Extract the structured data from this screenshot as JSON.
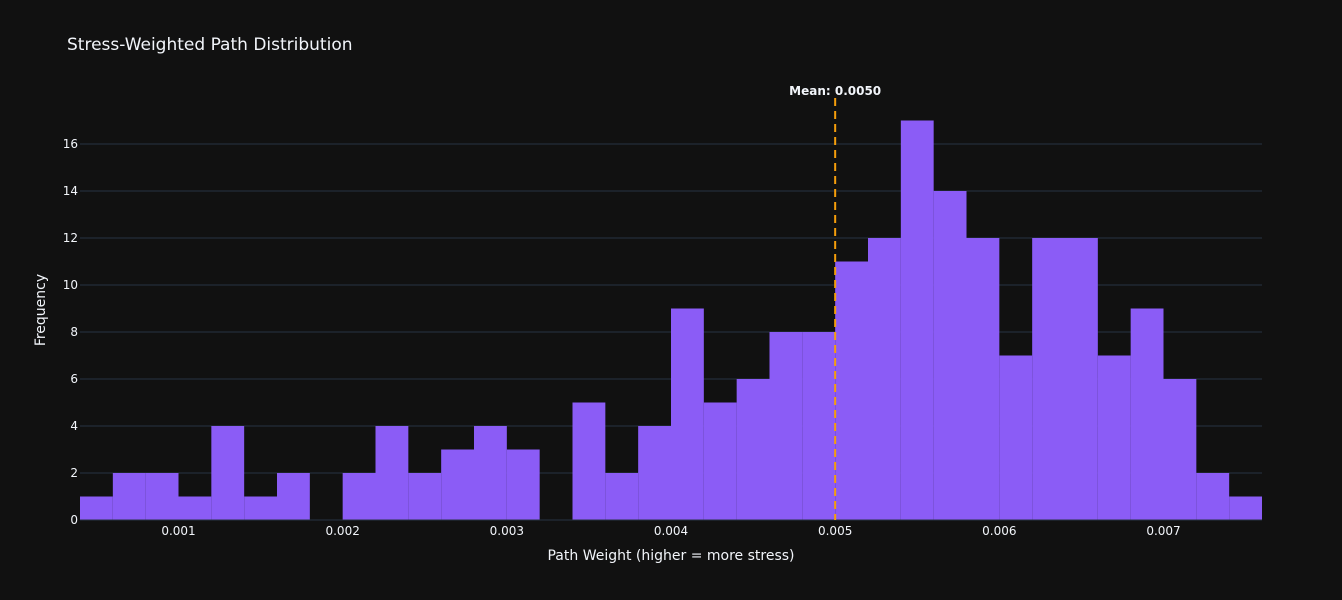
{
  "chart_data": {
    "type": "bar",
    "title": "Stress-Weighted Path Distribution",
    "xlabel": "Path Weight (higher = more stress)",
    "ylabel": "Frequency",
    "xlim": [
      0.0004,
      0.0076
    ],
    "ylim": [
      0,
      18
    ],
    "bin_width": 0.0002,
    "x_ticks": [
      0.001,
      0.002,
      0.003,
      0.004,
      0.005,
      0.006,
      0.007
    ],
    "x_tick_labels": [
      "0.001",
      "0.002",
      "0.003",
      "0.004",
      "0.005",
      "0.006",
      "0.007"
    ],
    "y_ticks": [
      0,
      2,
      4,
      6,
      8,
      10,
      12,
      14,
      16
    ],
    "y_tick_labels": [
      "0",
      "2",
      "4",
      "6",
      "8",
      "10",
      "12",
      "14",
      "16"
    ],
    "grid": true,
    "bar_color": "#8b5cf6",
    "bins_start": [
      0.0004,
      0.0006,
      0.0008,
      0.001,
      0.0012,
      0.0014,
      0.0016,
      0.0018,
      0.002,
      0.0022,
      0.0024,
      0.0026,
      0.0028,
      0.003,
      0.0032,
      0.0034,
      0.0036,
      0.0038,
      0.004,
      0.0042,
      0.0044,
      0.0046,
      0.0048,
      0.005,
      0.0052,
      0.0054,
      0.0056,
      0.0058,
      0.006,
      0.0062,
      0.0064,
      0.0066,
      0.0068,
      0.007,
      0.0072,
      0.0074
    ],
    "values": [
      1,
      2,
      2,
      1,
      4,
      1,
      2,
      0,
      2,
      4,
      2,
      3,
      4,
      3,
      0,
      5,
      2,
      4,
      9,
      5,
      6,
      8,
      8,
      11,
      12,
      17,
      14,
      12,
      7,
      12,
      12,
      7,
      9,
      6,
      2,
      1
    ],
    "mean_line": {
      "x": 0.005,
      "label": "Mean: 0.0050",
      "color": "#f59e0b"
    }
  }
}
